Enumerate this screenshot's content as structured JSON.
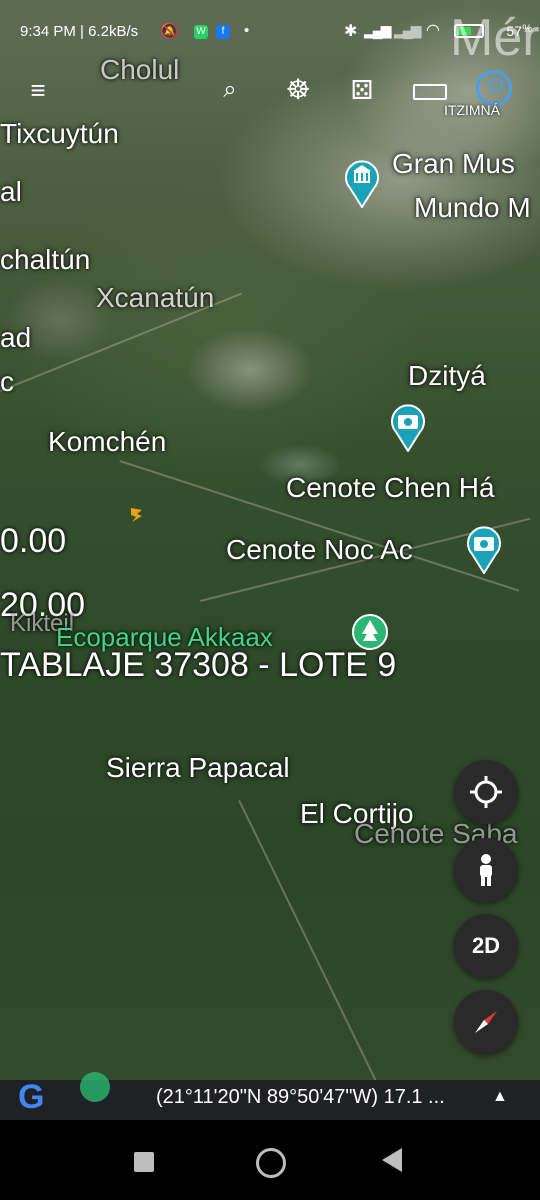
{
  "status_bar": {
    "time_speed": "9:34 PM | 6.2kB/s",
    "battery": "57"
  },
  "toolbar": {
    "place_label": "ITZIMNÁ",
    "corner_label": "Mér"
  },
  "map_labels": [
    {
      "id": "cholul",
      "text": "Cholul"
    },
    {
      "id": "tixcuytun",
      "text": "Tixcuytún"
    },
    {
      "id": "al",
      "text": "al"
    },
    {
      "id": "chaltun",
      "text": "chaltún"
    },
    {
      "id": "xcanatun",
      "text": "Xcanatún"
    },
    {
      "id": "ad",
      "text": "ad"
    },
    {
      "id": "c",
      "text": "c"
    },
    {
      "id": "gran-mus",
      "text": "Gran Mus"
    },
    {
      "id": "mundo",
      "text": "Mundo M"
    },
    {
      "id": "dzitya",
      "text": "Dzityá"
    },
    {
      "id": "komchen",
      "text": "Komchén"
    },
    {
      "id": "cenote-chen-ha",
      "text": "Cenote Chen Há"
    },
    {
      "id": "val-1",
      "text": "0.00"
    },
    {
      "id": "cenote-noc-ac",
      "text": "Cenote Noc Ac"
    },
    {
      "id": "val-2",
      "text": "20.00"
    },
    {
      "id": "kikteil",
      "text": "Kikteil"
    },
    {
      "id": "ecoparque",
      "text": "Ecoparque Akkaax"
    },
    {
      "id": "tablaje",
      "text": "TABLAJE 37308 - LOTE 9"
    },
    {
      "id": "sierra-papacal",
      "text": "Sierra Papacal"
    },
    {
      "id": "el-cortijo",
      "text": "El Cortijo"
    },
    {
      "id": "cenote-saba",
      "text": "Cenote Saba"
    }
  ],
  "controls": {
    "view_mode_label": "2D"
  },
  "bottom": {
    "coordinates": "(21°11'20\"N 89°50'47\"W) 17.1 ..."
  },
  "colors": {
    "accent_blue": "#4a9eea",
    "pin_teal": "#1aa3b8",
    "park_green": "#3fd48a"
  }
}
